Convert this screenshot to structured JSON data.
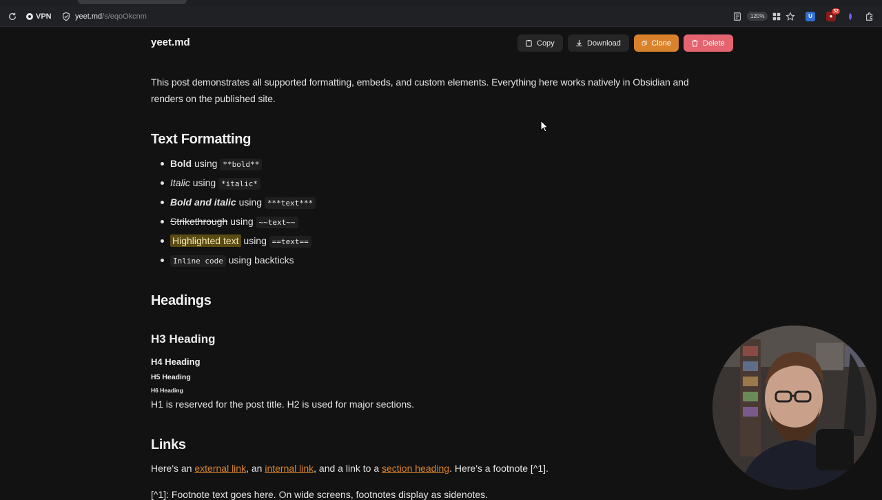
{
  "browser": {
    "vpn_label": "VPN",
    "url_host": "yeet.md",
    "url_path": "/s/eqoOkcnm",
    "zoom": "120%",
    "ext_badge": "32"
  },
  "header": {
    "site_title": "yeet.md",
    "copy_label": "Copy",
    "download_label": "Download",
    "clone_label": "Clone",
    "delete_label": "Delete"
  },
  "colors": {
    "accent": "#d9822b",
    "danger": "#e5636e",
    "background": "#121212"
  },
  "post": {
    "intro": "This post demonstrates all supported formatting, embeds, and custom elements. Everything here works natively in Obsidian and renders on the published site.",
    "text_formatting": {
      "heading": "Text Formatting",
      "items": [
        {
          "label": "Bold",
          "using": "using",
          "code": "**bold**"
        },
        {
          "label": "Italic",
          "using": "using",
          "code": "*italic*"
        },
        {
          "label": "Bold and italic",
          "using": "using",
          "code": "***text***"
        },
        {
          "label": "Strikethrough",
          "using": "using",
          "code": "~~text~~"
        },
        {
          "label": "Highlighted text",
          "using": "using",
          "code": "==text=="
        },
        {
          "label": "Inline code",
          "rest": "using backticks"
        }
      ]
    },
    "headings": {
      "heading": "Headings",
      "h3": "H3 Heading",
      "h4": "H4 Heading",
      "h5": "H5 Heading",
      "h6": "H6 Heading",
      "note": "H1 is reserved for the post title. H2 is used for major sections."
    },
    "links": {
      "heading": "Links",
      "prefix": "Here's an",
      "external": "external link",
      "sep1": ", an",
      "internal": "internal link",
      "sep2": ", and a link to a",
      "section": "section heading",
      "suffix": ". Here's a footnote [^1].",
      "footnote_text": "[^1]: Footnote text goes here. On wide screens, footnotes display as sidenotes."
    }
  }
}
